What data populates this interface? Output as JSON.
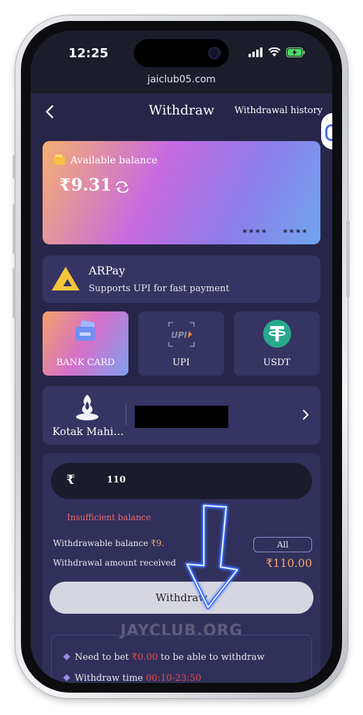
{
  "status_bar": {
    "time": "12:25",
    "url": "jaiclub05.com"
  },
  "header": {
    "title": "Withdraw",
    "history_link": "Withdrawal history"
  },
  "balance": {
    "label": "Available balance",
    "amount": "₹9.31",
    "card_mask_1": "****",
    "card_mask_2": "****"
  },
  "gateway": {
    "name": "ARPay",
    "description": "Supports UPI for fast payment"
  },
  "methods": [
    {
      "label": "BANK CARD",
      "icon": "bank-card-icon",
      "active": true
    },
    {
      "label": "UPI",
      "icon": "upi-icon",
      "active": false
    },
    {
      "label": "USDT",
      "icon": "tether-icon",
      "active": false
    }
  ],
  "bank": {
    "name": "Kotak Mahi…"
  },
  "form": {
    "currency_symbol": "₹",
    "amount_value": "110",
    "error": "Insufficient balance",
    "withdrawable_label": "Withdrawable balance",
    "withdrawable_value": "₹9.",
    "all_button": "All",
    "received_label": "Withdrawal amount received",
    "received_value": "₹110.00",
    "withdraw_button": "Withdraw"
  },
  "watermark": "JAYCLUB.ORG",
  "notes": [
    {
      "prefix": "Need to bet ",
      "value": "₹0.00",
      "suffix": " to be able to withdraw"
    },
    {
      "prefix": "Withdraw time ",
      "value": "00:10-23:50",
      "suffix": ""
    }
  ],
  "colors": {
    "background": "#272649",
    "card": "#353462",
    "accent_orange": "#f6a86a",
    "error_red": "#ee6a6a",
    "arrow_glow": "#3b6cff"
  }
}
